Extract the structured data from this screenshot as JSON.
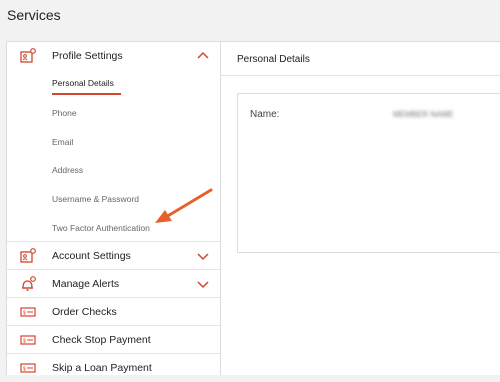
{
  "page": {
    "title": "Services"
  },
  "sidebar": {
    "profile_settings": {
      "label": "Profile Settings",
      "subitems": [
        {
          "label": "Personal Details",
          "active": true
        },
        {
          "label": "Phone"
        },
        {
          "label": "Email"
        },
        {
          "label": "Address"
        },
        {
          "label": "Username & Password"
        },
        {
          "label": "Two Factor Authentication"
        }
      ]
    },
    "items": [
      {
        "label": "Account Settings",
        "icon": "id-card-gear-icon"
      },
      {
        "label": "Manage Alerts",
        "icon": "bell-gear-icon"
      },
      {
        "label": "Order Checks",
        "icon": "check-icon"
      },
      {
        "label": "Check Stop Payment",
        "icon": "check-icon"
      },
      {
        "label": "Skip a Loan Payment",
        "icon": "check-icon"
      }
    ]
  },
  "main": {
    "title": "Personal Details",
    "fields": [
      {
        "label": "Name:",
        "value": "MEMBER NAME"
      }
    ]
  },
  "colors": {
    "accent": "#d0472c",
    "annotation_arrow": "#e8602c"
  }
}
